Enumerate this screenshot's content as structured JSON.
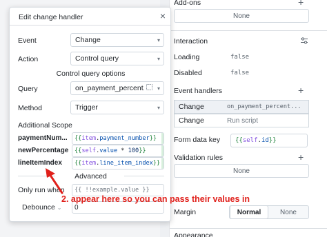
{
  "modal": {
    "title": "Edit change handler",
    "event_label": "Event",
    "event_value": "Change",
    "action_label": "Action",
    "action_value": "Control query",
    "options_header": "Control query options",
    "query_label": "Query",
    "query_value": "on_payment_percent...",
    "method_label": "Method",
    "method_value": "Trigger",
    "additional_scope": "Additional Scope",
    "scope": [
      {
        "name": "paymentNum...",
        "code": [
          [
            "{{ ",
            "brace"
          ],
          [
            "item",
            "var"
          ],
          [
            ".",
            ""
          ],
          [
            "payment_number",
            "prop"
          ],
          [
            " }}",
            "brace"
          ]
        ]
      },
      {
        "name": "newPercentage",
        "code": [
          [
            "{{",
            "brace"
          ],
          [
            "self",
            "var"
          ],
          [
            ".",
            ""
          ],
          [
            "value",
            "prop"
          ],
          [
            " * ",
            ""
          ],
          [
            "100",
            "num"
          ],
          [
            "}}",
            "brace"
          ]
        ]
      },
      {
        "name": "lineItemIndex",
        "code": [
          [
            "{{ ",
            "brace"
          ],
          [
            "item",
            "var"
          ],
          [
            ".",
            ""
          ],
          [
            "line_item_index",
            "prop"
          ],
          [
            " }}",
            "brace"
          ]
        ]
      }
    ],
    "advanced": "Advanced",
    "only_run_when_label": "Only run when",
    "only_run_when_value": "{{ !!example.value }}",
    "debounce_label": "Debounce",
    "debounce_value": "0"
  },
  "panel": {
    "addons_title": "Add-ons",
    "addons_none": "None",
    "interaction_title": "Interaction",
    "loading_label": "Loading",
    "loading_value": "false",
    "disabled_label": "Disabled",
    "disabled_value": "false",
    "handlers_title": "Event handlers",
    "handlers": [
      {
        "event": "Change",
        "action": "on_payment_percent..."
      },
      {
        "event": "Change",
        "action": "Run script"
      }
    ],
    "form_key_label": "Form data key",
    "form_key_value": "{{ self.id }}",
    "validation_title": "Validation rules",
    "validation_none": "None",
    "margin_label": "Margin",
    "margin_options": [
      "Normal",
      "None"
    ],
    "margin_selected": "Normal",
    "appearance_title": "Appearance"
  },
  "annotation": "2. appear here so you can pass their values in",
  "colors": {
    "annotation": "#e0201b",
    "code_brace": "#1a7f37",
    "code_var": "#8250df",
    "code_prop": "#0550ae"
  }
}
